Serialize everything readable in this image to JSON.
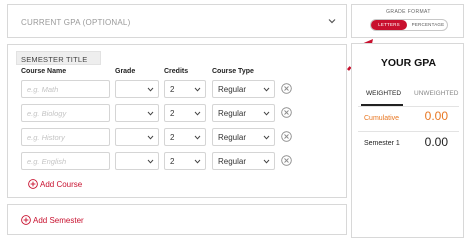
{
  "current_gpa": {
    "label": "CURRENT GPA (OPTIONAL)"
  },
  "semester": {
    "title": "SEMESTER TITLE",
    "columns": {
      "course_name": "Course Name",
      "grade": "Grade",
      "credits": "Credits",
      "course_type": "Course Type"
    },
    "rows": [
      {
        "placeholder": "e.g. Math",
        "grade": "",
        "credits": "2",
        "course_type": "Regular"
      },
      {
        "placeholder": "e.g. Biology",
        "grade": "",
        "credits": "2",
        "course_type": "Regular"
      },
      {
        "placeholder": "e.g. History",
        "grade": "",
        "credits": "2",
        "course_type": "Regular"
      },
      {
        "placeholder": "e.g. English",
        "grade": "",
        "credits": "2",
        "course_type": "Regular"
      }
    ],
    "add_course": "Add Course"
  },
  "add_semester": "Add Semester",
  "grade_format": {
    "title": "GRADE FORMAT",
    "options": [
      "LETTERS",
      "PERCENTAGE"
    ],
    "selected": "LETTERS"
  },
  "your_gpa": {
    "title": "YOUR GPA",
    "tabs": [
      "WEIGHTED",
      "UNWEIGHTED"
    ],
    "active_tab": "WEIGHTED",
    "cumulative_label": "Cumulative",
    "cumulative_value": "0.00",
    "semesters": [
      {
        "label": "Semester 1",
        "value": "0.00"
      }
    ]
  },
  "colors": {
    "accent": "#c8102e",
    "cumulative": "#e87722"
  },
  "icons": {
    "current_gpa_toggle": "chevron-down-icon",
    "remove_row": "circle-x-icon",
    "add": "circle-plus-icon",
    "pointer": "dashed-arrow-icon"
  }
}
